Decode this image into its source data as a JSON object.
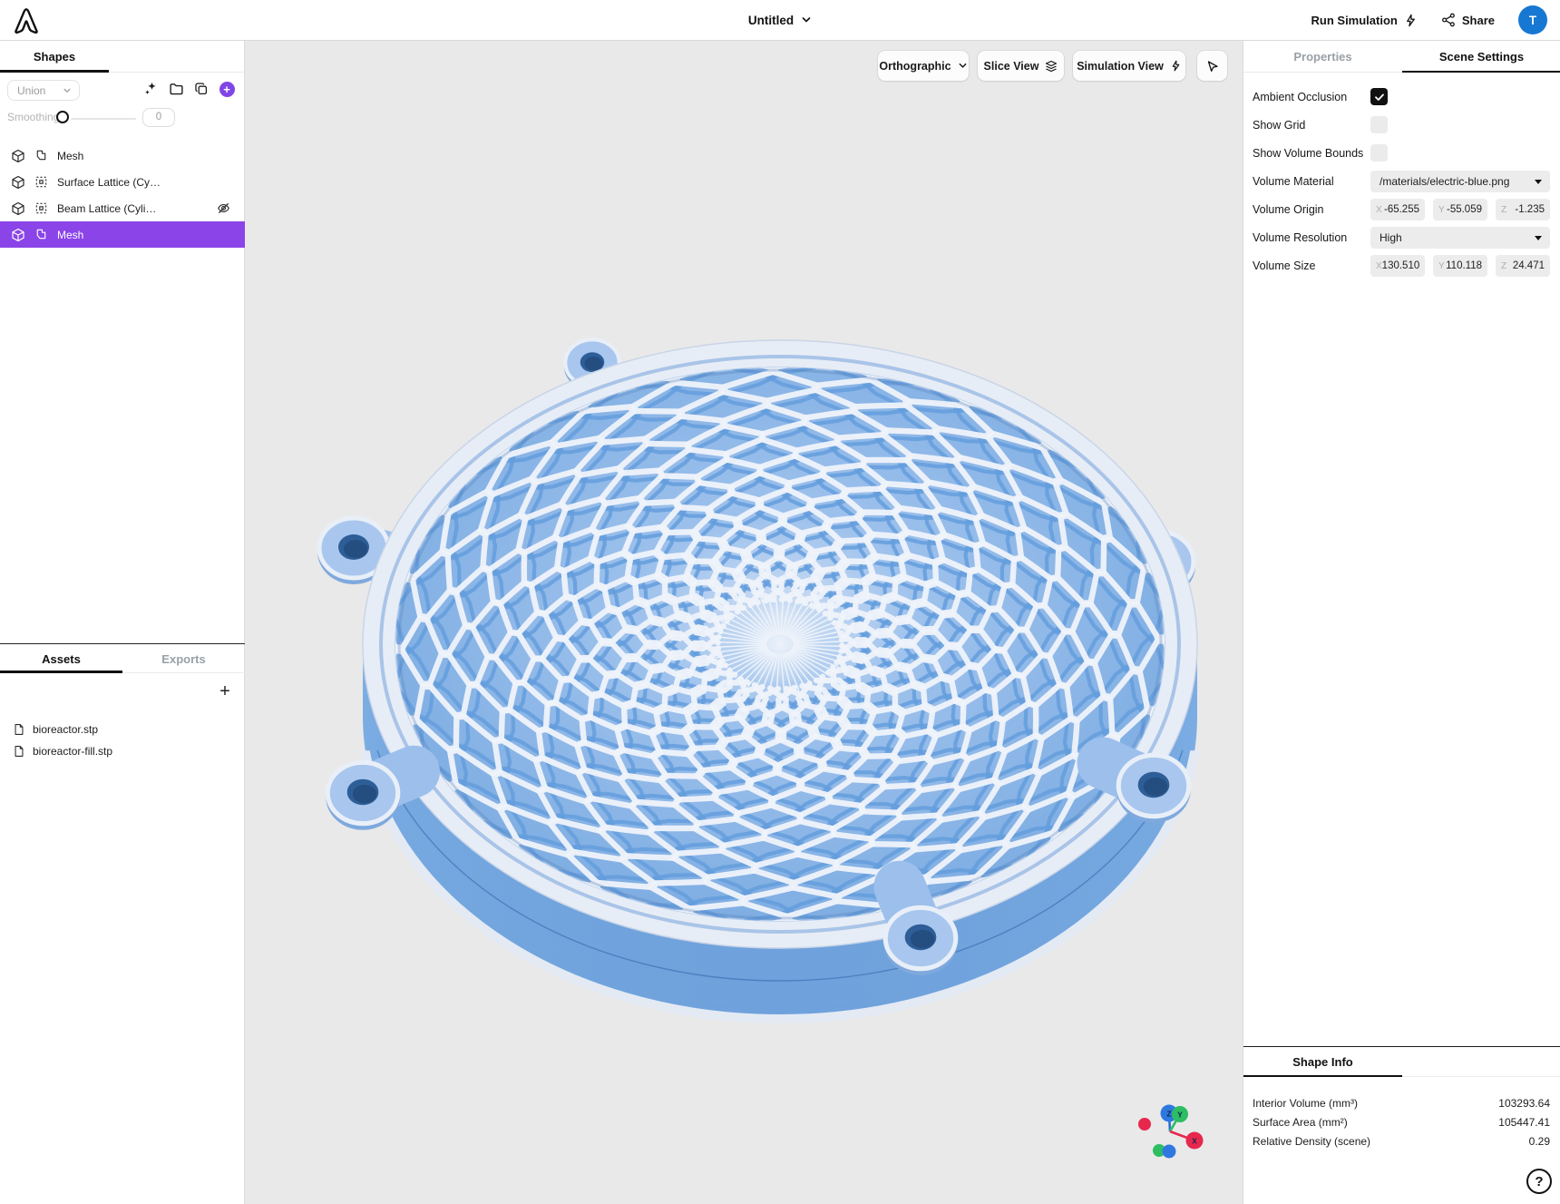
{
  "app": {
    "title": "Untitled"
  },
  "topbar": {
    "run_simulation": "Run Simulation",
    "share": "Share",
    "avatar_initial": "T"
  },
  "left_panel": {
    "shapes_tab": "Shapes",
    "boolean_op": "Union",
    "smoothing_label": "Smoothing",
    "smoothing_value": "0",
    "shapes": [
      {
        "label": "Mesh",
        "type": "mesh",
        "hidden": false,
        "selected": false
      },
      {
        "label": "Surface Lattice (Cy…",
        "type": "lattice",
        "hidden": false,
        "selected": false
      },
      {
        "label": "Beam Lattice (Cyli…",
        "type": "lattice",
        "hidden": true,
        "selected": false
      },
      {
        "label": "Mesh",
        "type": "mesh",
        "hidden": false,
        "selected": true
      }
    ],
    "assets_tab": "Assets",
    "exports_tab": "Exports",
    "files": [
      {
        "name": "bioreactor.stp"
      },
      {
        "name": "bioreactor-fill.stp"
      }
    ]
  },
  "viewport": {
    "projection": "Orthographic",
    "slice_view": "Slice View",
    "simulation_view": "Simulation View",
    "axis_labels": {
      "x": "X",
      "y": "Y",
      "z": "Z"
    }
  },
  "right_panel": {
    "tabs": {
      "properties": "Properties",
      "scene_settings": "Scene Settings"
    },
    "ambient_occlusion_label": "Ambient Occlusion",
    "ambient_occlusion_checked": true,
    "show_grid_label": "Show Grid",
    "show_grid_checked": false,
    "show_volume_bounds_label": "Show Volume Bounds",
    "show_volume_bounds_checked": false,
    "volume_material_label": "Volume Material",
    "volume_material_value": "/materials/electric-blue.png",
    "volume_origin_label": "Volume Origin",
    "volume_origin": {
      "x": "-65.255",
      "y": "-55.059",
      "z": "-1.235"
    },
    "volume_resolution_label": "Volume Resolution",
    "volume_resolution_value": "High",
    "volume_size_label": "Volume Size",
    "volume_size": {
      "x": "130.510",
      "y": "110.118",
      "z": "24.471"
    },
    "axis_field_labels": {
      "x": "X",
      "y": "Y",
      "z": "Z"
    }
  },
  "shape_info": {
    "title": "Shape Info",
    "rows": [
      {
        "label": "Interior Volume (mm³)",
        "value": "103293.64"
      },
      {
        "label": "Surface Area (mm²)",
        "value": "105447.41"
      },
      {
        "label": "Relative Density (scene)",
        "value": "0.29"
      }
    ],
    "help": "?"
  },
  "colors": {
    "accent_purple": "#8b44e8",
    "avatar_blue": "#1678d2",
    "object_blue": "#7aabe2",
    "object_ridge_white": "#eef3fa",
    "viewport_bg": "#e9e9e9",
    "axis_x_red": "#e62e55",
    "axis_y_green": "#2ec468",
    "axis_z_blue": "#2e78e0"
  }
}
